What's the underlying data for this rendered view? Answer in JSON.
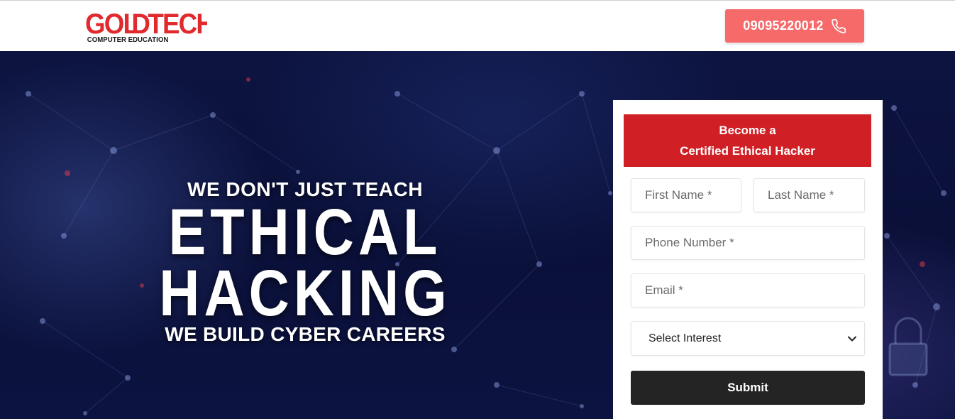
{
  "header": {
    "logo_main_left": "GOL",
    "logo_main_mid": "D",
    "logo_main_right": "TECH",
    "logo_sub": "COMPUTER EDUCATION",
    "phone_label": "09095220012"
  },
  "hero": {
    "line1": "WE DON'T JUST TEACH",
    "line2": "ETHICAL",
    "line3": "HACKING",
    "line4": "WE BUILD CYBER CAREERS"
  },
  "form": {
    "title_line1": "Become a",
    "title_line2": "Certified Ethical Hacker",
    "first_name_placeholder": "First Name *",
    "last_name_placeholder": "Last Name *",
    "phone_placeholder": "Phone Number *",
    "email_placeholder": "Email *",
    "interest_selected": "Select Interest",
    "submit_label": "Submit"
  },
  "colors": {
    "brand_red": "#d02025",
    "phone_button": "#f76a6a",
    "submit_button": "#242424",
    "hero_background": "#0b1035"
  },
  "icons": {
    "phone": "phone-icon",
    "dropdown": "chevron-down-icon"
  }
}
